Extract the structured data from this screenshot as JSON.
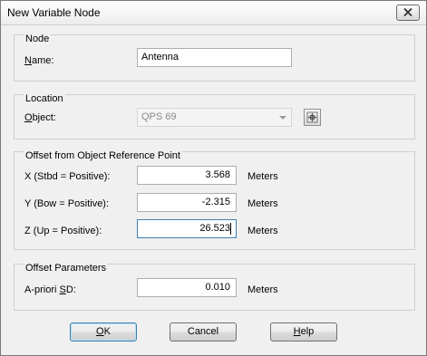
{
  "window": {
    "title": "New Variable Node"
  },
  "node_group": {
    "title": "Node",
    "name_label_ul": "N",
    "name_label_rest": "ame:",
    "name_value": "Antenna"
  },
  "location_group": {
    "title": "Location",
    "object_label_ul": "O",
    "object_label_rest": "bject:",
    "object_value": "QPS 69"
  },
  "offset_group": {
    "title": "Offset from Object Reference Point",
    "rows": [
      {
        "label": "X  (Stbd = Positive):",
        "value": "3.568",
        "unit": "Meters"
      },
      {
        "label": "Y  (Bow = Positive):",
        "value": "-2.315",
        "unit": "Meters"
      },
      {
        "label": "Z  (Up = Positive):",
        "value": "26.523",
        "unit": "Meters"
      }
    ]
  },
  "offset_params_group": {
    "title": "Offset Parameters",
    "apriori_label_pre": "A-priori ",
    "apriori_label_ul": "S",
    "apriori_label_post": "D:",
    "apriori_value": "0.010",
    "apriori_unit": "Meters"
  },
  "buttons": {
    "ok_ul": "O",
    "ok_rest": "K",
    "cancel": "Cancel",
    "help_ul": "H",
    "help_rest": "elp"
  }
}
